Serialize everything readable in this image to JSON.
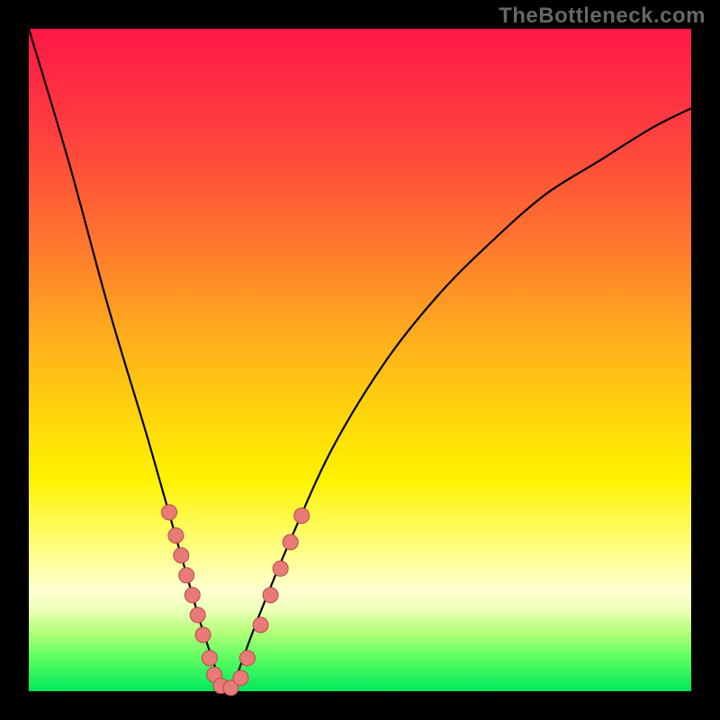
{
  "watermark": "TheBottleneck.com",
  "colors": {
    "frame": "#000000",
    "curve_stroke": "#000000",
    "marker_fill": "#e87a77",
    "marker_stroke": "#b84b4b",
    "gradient_top": "#ff1846",
    "gradient_mid": "#fff200",
    "gradient_bottom": "#00e85d"
  },
  "chart_data": {
    "type": "line",
    "title": "",
    "xlabel": "",
    "ylabel": "",
    "xlim": [
      0,
      100
    ],
    "ylim": [
      0,
      100
    ],
    "axes_visible": false,
    "background": "vertical rainbow gradient (red→yellow→green)",
    "series": [
      {
        "name": "bottleneck-valley-curve",
        "x": [
          0,
          6,
          12,
          18,
          22,
          24,
          26,
          28,
          29,
          30,
          31,
          32,
          35,
          40,
          46,
          54,
          62,
          70,
          78,
          86,
          94,
          100
        ],
        "y": [
          100,
          80,
          58,
          38,
          24,
          17,
          10,
          4,
          1,
          0,
          1,
          4,
          12,
          24,
          37,
          50,
          60,
          68,
          75,
          80,
          85,
          88
        ]
      }
    ],
    "markers": [
      {
        "x": 21.2,
        "y": 27.0
      },
      {
        "x": 22.2,
        "y": 23.5
      },
      {
        "x": 23.0,
        "y": 20.5
      },
      {
        "x": 23.8,
        "y": 17.5
      },
      {
        "x": 24.7,
        "y": 14.5
      },
      {
        "x": 25.5,
        "y": 11.5
      },
      {
        "x": 26.3,
        "y": 8.5
      },
      {
        "x": 27.3,
        "y": 5.0
      },
      {
        "x": 28.0,
        "y": 2.5
      },
      {
        "x": 29.0,
        "y": 0.8
      },
      {
        "x": 30.5,
        "y": 0.5
      },
      {
        "x": 32.0,
        "y": 2.0
      },
      {
        "x": 33.0,
        "y": 5.0
      },
      {
        "x": 35.0,
        "y": 10.0
      },
      {
        "x": 36.5,
        "y": 14.5
      },
      {
        "x": 38.0,
        "y": 18.5
      },
      {
        "x": 39.5,
        "y": 22.5
      },
      {
        "x": 41.2,
        "y": 26.5
      }
    ],
    "notes": "Deep valley curve with minimum near x≈30. Salmon markers cluster along both valley walls in the yellow/green band (roughly y 0–27)."
  }
}
